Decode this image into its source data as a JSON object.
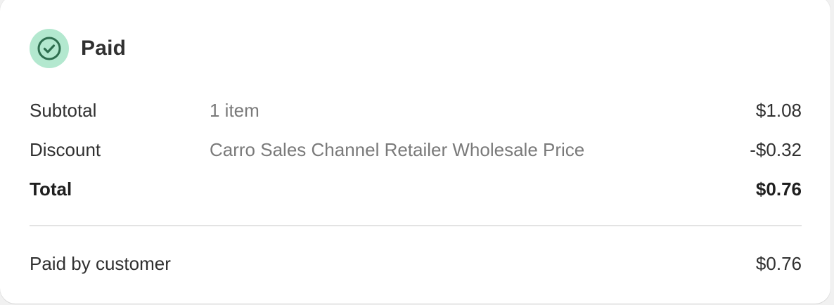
{
  "status": {
    "title": "Paid",
    "icon": "check-circle-icon",
    "icon_color": "#2e6e4f",
    "badge_color": "#b3e8cf"
  },
  "summary": {
    "subtotal": {
      "label": "Subtotal",
      "description": "1 item",
      "amount": "$1.08"
    },
    "discount": {
      "label": "Discount",
      "description": "Carro Sales Channel Retailer Wholesale Price",
      "amount": "-$0.32"
    },
    "total": {
      "label": "Total",
      "amount": "$0.76"
    }
  },
  "payment": {
    "label": "Paid by customer",
    "amount": "$0.76"
  }
}
